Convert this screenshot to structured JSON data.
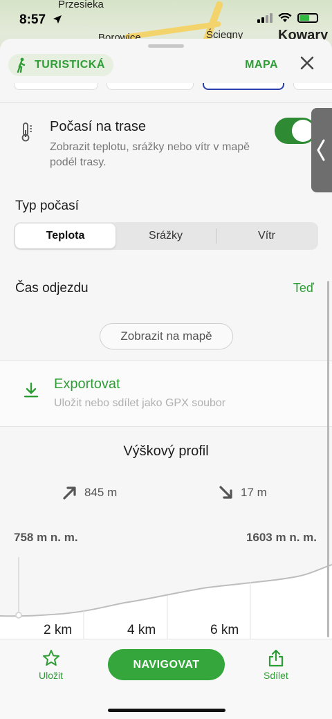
{
  "map": {
    "labels": [
      "Przesieka",
      "Borowice",
      "Ściegny",
      "Kowary"
    ]
  },
  "status": {
    "time": "8:57"
  },
  "header": {
    "chip_label": "TURISTICKÁ",
    "map_link": "MAPA"
  },
  "weather": {
    "title": "Počasí na trase",
    "description": "Zobrazit teplotu, srážky nebo vítr v mapě podél trasy.",
    "enabled": true
  },
  "weather_type": {
    "label": "Typ počasí",
    "options": [
      "Teplota",
      "Srážky",
      "Vítr"
    ],
    "selected": "Teplota"
  },
  "departure": {
    "label": "Čas odjezdu",
    "value": "Teď"
  },
  "show_on_map_label": "Zobrazit na mapě",
  "export": {
    "title": "Exportovat",
    "subtitle": "Uložit nebo sdílet jako GPX soubor"
  },
  "elevation": {
    "title": "Výškový profil",
    "ascent": "845 m",
    "descent": "17 m",
    "min_label": "758 m n. m.",
    "max_label": "1603 m n. m.",
    "km_labels": [
      "2 km",
      "4 km",
      "6 km"
    ]
  },
  "bottom": {
    "save_label": "Uložit",
    "navigate_label": "NAVIGOVAT",
    "share_label": "Sdílet"
  },
  "colors": {
    "accent": "#2f9d36",
    "toggle_on": "#2f8a34",
    "navigate_bg": "#34a63b"
  }
}
